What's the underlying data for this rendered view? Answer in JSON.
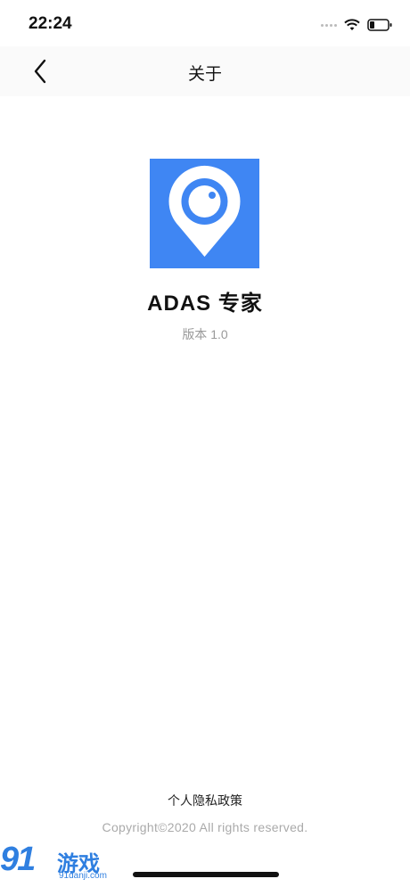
{
  "status_bar": {
    "time": "22:24",
    "icons": [
      "signal-dots-icon",
      "wifi-icon",
      "battery-icon"
    ]
  },
  "nav": {
    "title": "关于",
    "back_icon": "chevron-left-icon"
  },
  "app": {
    "name": "ADAS 专家",
    "version": "版本 1.0",
    "icon": "location-pin-camera-icon",
    "icon_color": "#3f86f3"
  },
  "footer": {
    "privacy_link": "个人隐私政策",
    "copyright": "Copyright©2020 All rights reserved."
  },
  "watermark": {
    "logo": "91",
    "text": "游戏",
    "url": "91danji.com"
  }
}
